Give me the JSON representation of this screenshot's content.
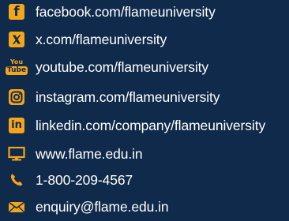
{
  "colors": {
    "background": "#0f2a4a",
    "accent": "#f3a51b",
    "text": "#ffffff"
  },
  "contacts": [
    {
      "icon": "facebook-icon",
      "text": "facebook.com/flameuniversity"
    },
    {
      "icon": "x-icon",
      "text": "x.com/flameuniversity"
    },
    {
      "icon": "youtube-icon",
      "text": "youtube.com/flameuniversity"
    },
    {
      "icon": "instagram-icon",
      "text": "instagram.com/flameuniversity"
    },
    {
      "icon": "linkedin-icon",
      "text": "linkedin.com/company/flameuniversity"
    },
    {
      "icon": "monitor-icon",
      "text": "www.flame.edu.in"
    },
    {
      "icon": "phone-icon",
      "text": "1-800-209-4567"
    },
    {
      "icon": "envelope-icon",
      "text": "enquiry@flame.edu.in"
    }
  ],
  "icon_glyphs": {
    "facebook": "f",
    "linkedin": "in",
    "youtube_top": "You",
    "youtube_bottom": "Tube"
  }
}
